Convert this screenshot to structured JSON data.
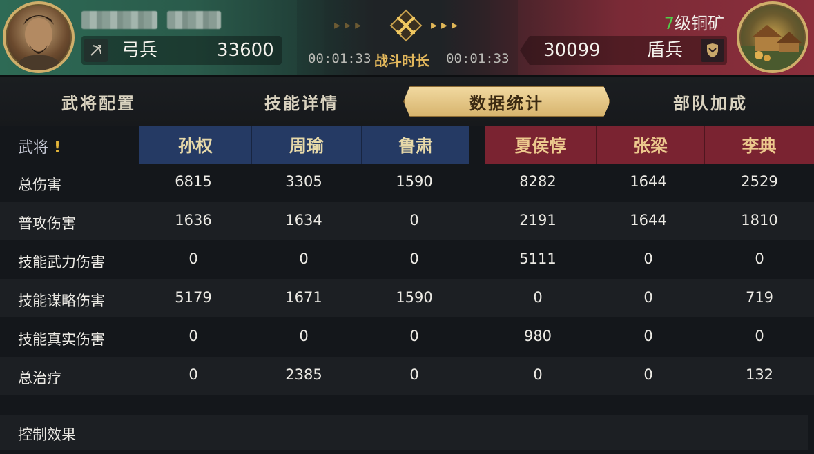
{
  "header": {
    "left": {
      "unit_icon": "bow-icon",
      "unit_name": "弓兵",
      "troops": "33600"
    },
    "center": {
      "time_left": "00:01:33",
      "label": "战斗时长",
      "time_right": "00:01:33",
      "arrows_left": "▸▸▸",
      "arrows_right": "▸▸▸"
    },
    "right": {
      "level_num": "7",
      "level_text": "级铜矿",
      "unit_name": "盾兵",
      "troops": "30099",
      "unit_icon": "shield-icon"
    }
  },
  "tabs": [
    {
      "label": "武将配置",
      "active": false
    },
    {
      "label": "技能详情",
      "active": false
    },
    {
      "label": "数据统计",
      "active": true
    },
    {
      "label": "部队加成",
      "active": false
    }
  ],
  "table": {
    "row_header_label": "武将",
    "warn_mark": "!",
    "generals_left": [
      "孙权",
      "周瑜",
      "鲁肃"
    ],
    "generals_right": [
      "夏侯惇",
      "张梁",
      "李典"
    ],
    "rows": [
      {
        "label": "总伤害",
        "values": [
          "6815",
          "3305",
          "1590",
          "8282",
          "1644",
          "2529"
        ]
      },
      {
        "label": "普攻伤害",
        "values": [
          "1636",
          "1634",
          "0",
          "2191",
          "1644",
          "1810"
        ]
      },
      {
        "label": "技能武力伤害",
        "values": [
          "0",
          "0",
          "0",
          "5111",
          "0",
          "0"
        ]
      },
      {
        "label": "技能谋略伤害",
        "values": [
          "5179",
          "1671",
          "1590",
          "0",
          "0",
          "719"
        ]
      },
      {
        "label": "技能真实伤害",
        "values": [
          "0",
          "0",
          "0",
          "980",
          "0",
          "0"
        ]
      },
      {
        "label": "总治疗",
        "values": [
          "0",
          "2385",
          "0",
          "0",
          "0",
          "132"
        ]
      }
    ],
    "control_label": "控制效果"
  },
  "colors": {
    "left_team": "#2e6a55",
    "right_team": "#8c2f3c",
    "gold_accent": "#e3b85c",
    "level_green": "#4fcf4a"
  }
}
